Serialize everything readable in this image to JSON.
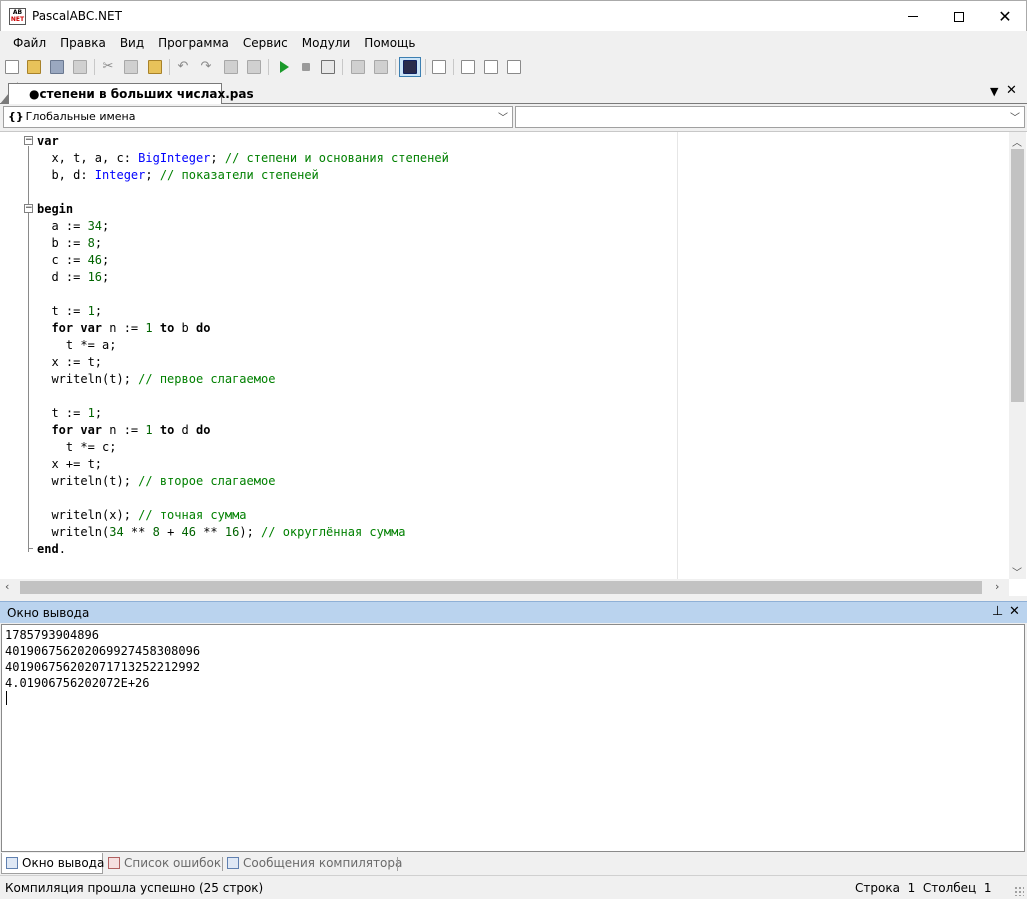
{
  "window": {
    "title": "PascalABC.NET",
    "icon_top": "AB",
    "icon_bottom": "NET"
  },
  "menu": [
    "Файл",
    "Правка",
    "Вид",
    "Программа",
    "Сервис",
    "Модули",
    "Помощь"
  ],
  "toolbar": {
    "buttons": [
      "new-file-icon",
      "open-folder-icon",
      "save-icon",
      "save-all-icon",
      "cut-icon",
      "copy-icon",
      "paste-icon",
      "undo-icon",
      "redo-icon",
      "step-back-icon",
      "step-forward-icon",
      "run-icon",
      "stop-icon",
      "debug-grid-icon",
      "comment-icon",
      "uncomment-icon",
      "console-icon",
      "format-icon",
      "module-d-icon",
      "module-l-icon",
      "module-r-icon"
    ]
  },
  "editor_tab": {
    "label": "●степени в больших числах.pas"
  },
  "combos": {
    "left_label": "Глобальные имена",
    "left_prefix": "{}",
    "right_label": ""
  },
  "code_lines": [
    [
      {
        "t": "var",
        "c": "kw",
        "b": true
      }
    ],
    [
      {
        "t": "  x, t, a, c: ",
        "c": "kw"
      },
      {
        "t": "BigInteger",
        "c": "ty"
      },
      {
        "t": "; ",
        "c": "kw"
      },
      {
        "t": "// степени и основания степеней",
        "c": "cm"
      }
    ],
    [
      {
        "t": "  b, d: ",
        "c": "kw"
      },
      {
        "t": "Integer",
        "c": "ty"
      },
      {
        "t": "; ",
        "c": "kw"
      },
      {
        "t": "// показатели степеней",
        "c": "cm"
      }
    ],
    [],
    [
      {
        "t": "begin",
        "c": "kw",
        "b": true
      }
    ],
    [
      {
        "t": "  a := ",
        "c": "kw"
      },
      {
        "t": "34",
        "c": "nm"
      },
      {
        "t": ";",
        "c": "kw"
      }
    ],
    [
      {
        "t": "  b := ",
        "c": "kw"
      },
      {
        "t": "8",
        "c": "nm"
      },
      {
        "t": ";",
        "c": "kw"
      }
    ],
    [
      {
        "t": "  c := ",
        "c": "kw"
      },
      {
        "t": "46",
        "c": "nm"
      },
      {
        "t": ";",
        "c": "kw"
      }
    ],
    [
      {
        "t": "  d := ",
        "c": "kw"
      },
      {
        "t": "16",
        "c": "nm"
      },
      {
        "t": ";",
        "c": "kw"
      }
    ],
    [],
    [
      {
        "t": "  t := ",
        "c": "kw"
      },
      {
        "t": "1",
        "c": "nm"
      },
      {
        "t": ";",
        "c": "kw"
      }
    ],
    [
      {
        "t": "  ",
        "c": "kw"
      },
      {
        "t": "for var",
        "c": "kw",
        "b": true
      },
      {
        "t": " n := ",
        "c": "kw"
      },
      {
        "t": "1",
        "c": "nm"
      },
      {
        "t": " ",
        "c": "kw"
      },
      {
        "t": "to",
        "c": "kw",
        "b": true
      },
      {
        "t": " b ",
        "c": "kw"
      },
      {
        "t": "do",
        "c": "kw",
        "b": true
      }
    ],
    [
      {
        "t": "    t *= a;",
        "c": "kw"
      }
    ],
    [
      {
        "t": "  x := t;",
        "c": "kw"
      }
    ],
    [
      {
        "t": "  writeln(t); ",
        "c": "kw"
      },
      {
        "t": "// первое слагаемое",
        "c": "cm"
      }
    ],
    [],
    [
      {
        "t": "  t := ",
        "c": "kw"
      },
      {
        "t": "1",
        "c": "nm"
      },
      {
        "t": ";",
        "c": "kw"
      }
    ],
    [
      {
        "t": "  ",
        "c": "kw"
      },
      {
        "t": "for var",
        "c": "kw",
        "b": true
      },
      {
        "t": " n := ",
        "c": "kw"
      },
      {
        "t": "1",
        "c": "nm"
      },
      {
        "t": " ",
        "c": "kw"
      },
      {
        "t": "to",
        "c": "kw",
        "b": true
      },
      {
        "t": " d ",
        "c": "kw"
      },
      {
        "t": "do",
        "c": "kw",
        "b": true
      }
    ],
    [
      {
        "t": "    t *= c;",
        "c": "kw"
      }
    ],
    [
      {
        "t": "  x += t;",
        "c": "kw"
      }
    ],
    [
      {
        "t": "  writeln(t); ",
        "c": "kw"
      },
      {
        "t": "// второе слагаемое",
        "c": "cm"
      }
    ],
    [],
    [
      {
        "t": "  writeln(x); ",
        "c": "kw"
      },
      {
        "t": "// точная сумма",
        "c": "cm"
      }
    ],
    [
      {
        "t": "  writeln(",
        "c": "kw"
      },
      {
        "t": "34",
        "c": "nm"
      },
      {
        "t": " ** ",
        "c": "kw"
      },
      {
        "t": "8",
        "c": "nm"
      },
      {
        "t": " + ",
        "c": "kw"
      },
      {
        "t": "46",
        "c": "nm"
      },
      {
        "t": " ** ",
        "c": "kw"
      },
      {
        "t": "16",
        "c": "nm"
      },
      {
        "t": "); ",
        "c": "kw"
      },
      {
        "t": "// округлённая сумма",
        "c": "cm"
      }
    ],
    [
      {
        "t": "end",
        "c": "kw",
        "b": true
      },
      {
        "t": ".",
        "c": "kw"
      }
    ]
  ],
  "output": {
    "title": "Окно вывода",
    "lines": [
      "1785793904896",
      "401906756202069927458308096",
      "401906756202071713252212992",
      "4.01906756202072E+26"
    ]
  },
  "bottom_tabs": [
    {
      "label": "Окно вывода",
      "active": true
    },
    {
      "label": "Список ошибок",
      "active": false
    },
    {
      "label": "Сообщения компилятора",
      "active": false
    }
  ],
  "status": {
    "message": "Компиляция прошла успешно (25 строк)",
    "row_label": "Строка",
    "row_value": "1",
    "col_label": "Столбец",
    "col_value": "1"
  }
}
